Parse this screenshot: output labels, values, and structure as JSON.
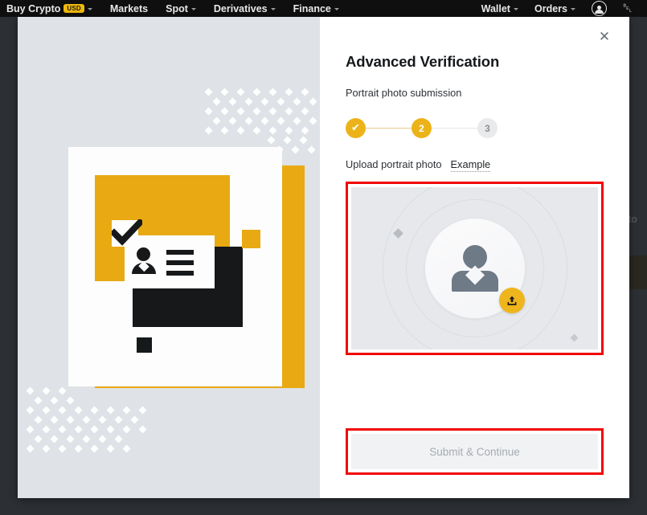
{
  "topnav": {
    "left_items": [
      {
        "label": "Buy Crypto",
        "badge": "USD",
        "has_caret": true
      },
      {
        "label": "Markets",
        "badge": "",
        "has_caret": false
      },
      {
        "label": "Spot",
        "badge": "",
        "has_caret": true
      },
      {
        "label": "Derivatives",
        "badge": "",
        "has_caret": true
      },
      {
        "label": "Finance",
        "badge": "",
        "has_caret": true
      }
    ],
    "right_items": [
      {
        "label": "Wallet",
        "has_caret": true
      },
      {
        "label": "Orders",
        "has_caret": true
      }
    ],
    "user_icon": "user-account-icon",
    "bell_icon": "notification-bell-icon",
    "bell_glyph": "␇"
  },
  "background": {
    "obscured_text": "h to"
  },
  "modal": {
    "close_label": "✕",
    "title": "Advanced Verification",
    "subtitle": "Portrait photo submission",
    "stepper": {
      "steps": [
        {
          "id": "1",
          "label": "✔",
          "state": "done"
        },
        {
          "id": "2",
          "label": "2",
          "state": "active"
        },
        {
          "id": "3",
          "label": "3",
          "state": "todo"
        }
      ]
    },
    "upload": {
      "label": "Upload portrait photo",
      "example_link": "Example",
      "dropzone_name": "portrait-photo-dropzone",
      "badge_icon": "upload-arrow-icon"
    },
    "submit": {
      "label": "Submit & Continue",
      "disabled": true
    }
  },
  "illustration": {
    "name": "identity-verification-illustration"
  },
  "colors": {
    "brand_yellow": "#ecb319",
    "illus_yellow": "#e8a913",
    "highlight_red": "#f20505",
    "nav_background": "#0f0f10",
    "page_backdrop": "#2c3034",
    "panel_gray": "#dfe2e6",
    "dropzone_gray": "#e6e8eb",
    "avatar_gray": "#6f7a87",
    "disabled_button": "#f1f2f3",
    "step_todo": "#e9eaec"
  }
}
